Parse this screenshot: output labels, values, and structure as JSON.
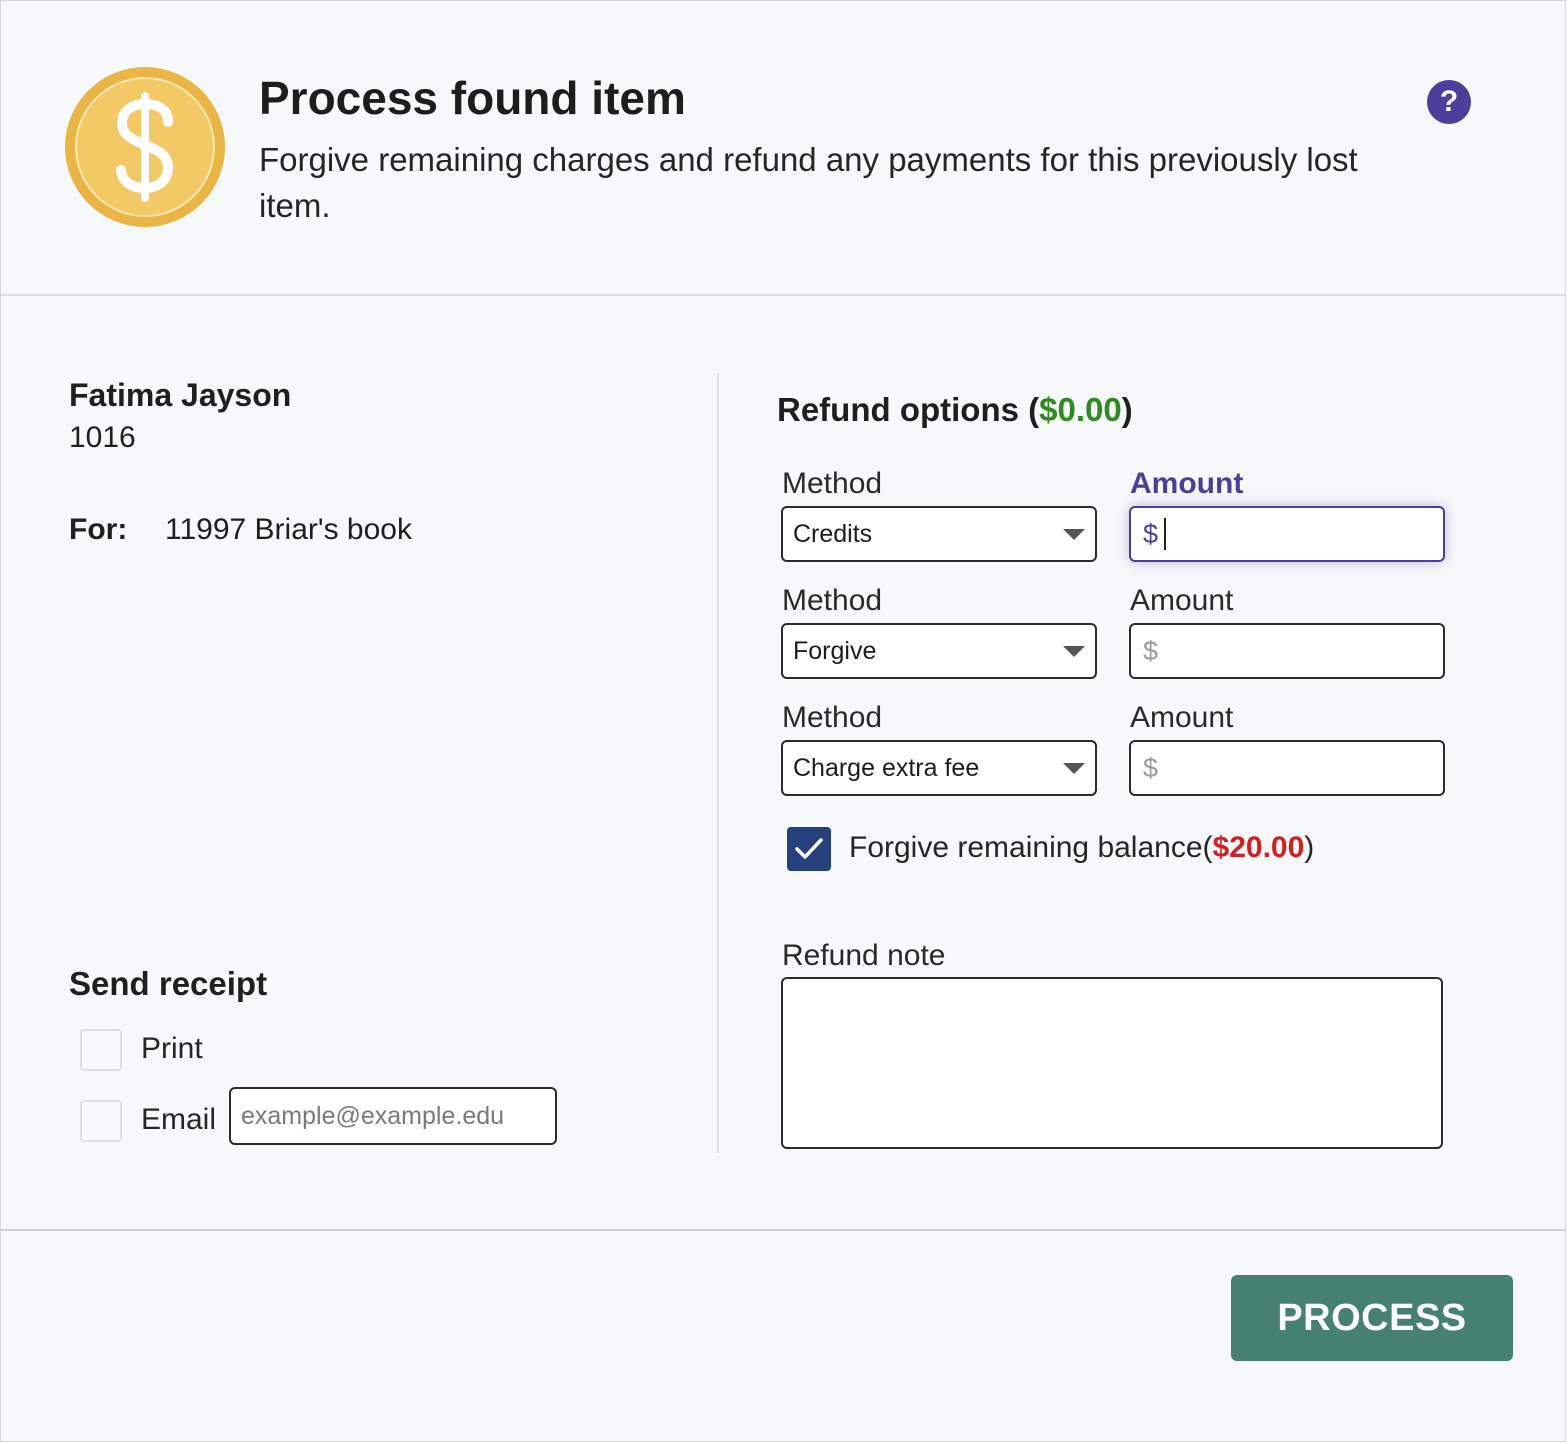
{
  "header": {
    "title": "Process found item",
    "subtitle": "Forgive remaining charges and refund any payments for this previously lost item.",
    "coin_icon": "dollar-coin-icon",
    "help_glyph": "?"
  },
  "patron": {
    "name": "Fatima Jayson",
    "id": "1016",
    "for_label": "For:",
    "for_value": "11997 Briar's book"
  },
  "refund": {
    "heading": "Refund options",
    "open_paren": "(",
    "total": "$0.00",
    "close_paren": ")",
    "rows": [
      {
        "method_label": "Method",
        "method_value": "Credits",
        "amount_label": "Amount",
        "amount_prefix": "$",
        "focused": true
      },
      {
        "method_label": "Method",
        "method_value": "Forgive",
        "amount_label": "Amount",
        "amount_prefix": "$"
      },
      {
        "method_label": "Method",
        "method_value": "Charge extra fee",
        "amount_label": "Amount",
        "amount_prefix": "$"
      }
    ],
    "forgive_label": "Forgive remaining balance",
    "forgive_open": "(",
    "forgive_amount": "$20.00",
    "forgive_close": ")",
    "forgive_checked": true,
    "note_label": "Refund note"
  },
  "receipt": {
    "heading": "Send receipt",
    "print_label": "Print",
    "email_label": "Email",
    "email_placeholder": "example@example.edu"
  },
  "footer": {
    "process_label": "PROCESS"
  },
  "colors": {
    "accent": "#4b3f9b",
    "positive": "#2e8b1e",
    "negative": "#d21f1f",
    "process_button": "#468070",
    "checkbox": "#25407a",
    "coin": "#e9b545"
  }
}
